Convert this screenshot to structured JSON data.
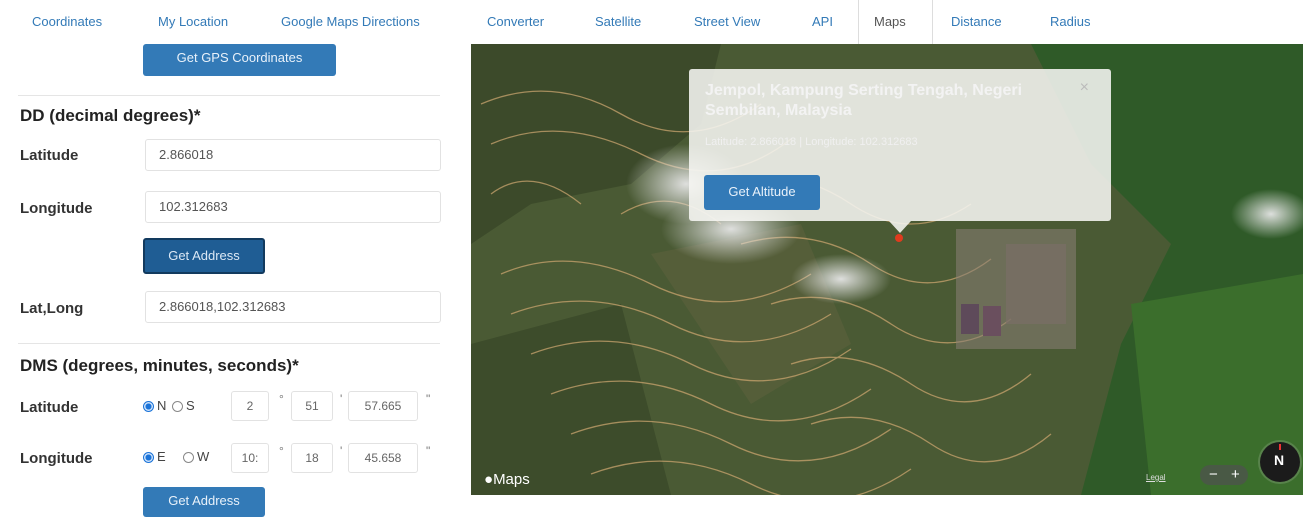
{
  "nav": {
    "tabs": [
      {
        "label": "Coordinates",
        "active": false
      },
      {
        "label": "My Location",
        "active": false
      },
      {
        "label": "Google Maps Directions",
        "active": false
      },
      {
        "label": "Converter",
        "active": false
      },
      {
        "label": "Satellite",
        "active": false
      },
      {
        "label": "Street View",
        "active": false
      },
      {
        "label": "API",
        "active": false
      },
      {
        "label": "Maps",
        "active": true
      },
      {
        "label": "Distance",
        "active": false
      },
      {
        "label": "Radius",
        "active": false
      }
    ]
  },
  "left": {
    "gps_button": "Get GPS Coordinates",
    "dd_heading": "DD (decimal degrees)*",
    "latitude_label": "Latitude",
    "latitude_value": "2.866018",
    "longitude_label": "Longitude",
    "longitude_value": "102.312683",
    "get_address_button": "Get Address",
    "latlong_label": "Lat,Long",
    "latlong_value": "2.866018,102.312683",
    "dms_heading": "DMS (degrees, minutes, seconds)*",
    "dms_lat": {
      "label": "Latitude",
      "opt1": "N",
      "opt2": "S",
      "selected": "N",
      "deg": "2",
      "min": "51",
      "sec": "57.665"
    },
    "dms_lon": {
      "label": "Longitude",
      "opt1": "E",
      "opt2": "W",
      "selected": "E",
      "deg": "10:",
      "min": "18",
      "sec": "45.658"
    },
    "get_address_button_2": "Get Address",
    "deg_symbol": "°",
    "min_symbol": "'",
    "sec_symbol": "\""
  },
  "map": {
    "popup_title": "Jempol, Kampung Serting Tengah, Negeri Sembilan, Malaysia",
    "popup_coords": "Latitude: 2.866018 | Longitude: 102.312683",
    "get_altitude_button": "Get Altitude",
    "close_symbol": "×",
    "logo": "Maps",
    "legal": "Legal",
    "zoom_out": "−",
    "zoom_in": "+",
    "compass": "N"
  },
  "colors": {
    "link": "#337ab7",
    "button": "#337ab7",
    "marker": "#e03b1e"
  }
}
